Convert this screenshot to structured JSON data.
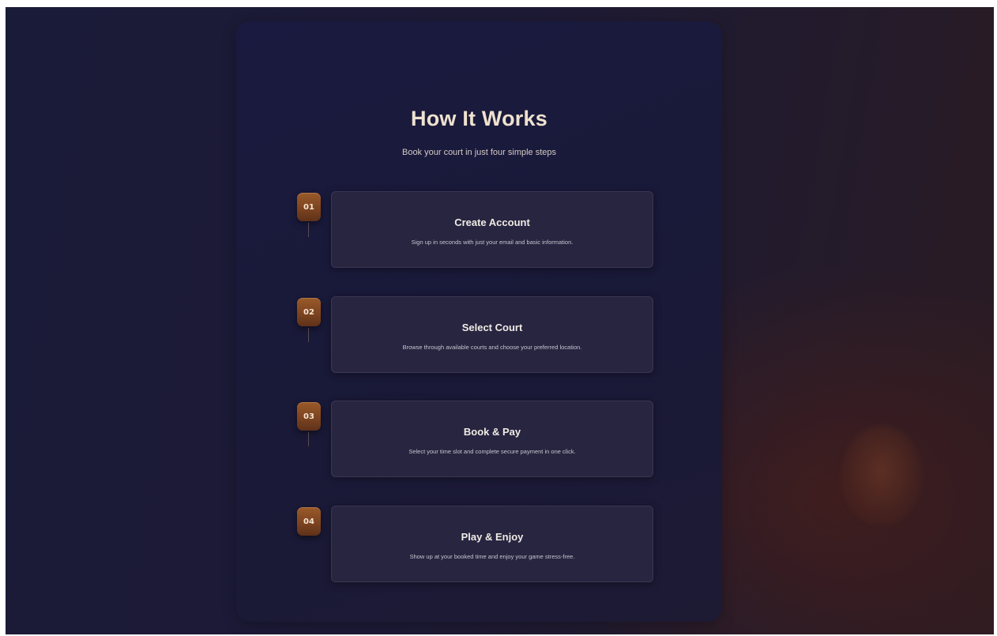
{
  "section": {
    "title": "How It Works",
    "subtitle": "Book your court in just four simple steps"
  },
  "steps": [
    {
      "number": "01",
      "title": "Create Account",
      "description": "Sign up in seconds with just your email and basic information."
    },
    {
      "number": "02",
      "title": "Select Court",
      "description": "Browse through available courts and choose your preferred location."
    },
    {
      "number": "03",
      "title": "Book & Pay",
      "description": "Select your time slot and complete secure payment in one click."
    },
    {
      "number": "04",
      "title": "Play & Enjoy",
      "description": "Show up at your booked time and enjoy your game stress-free."
    }
  ],
  "colors": {
    "accent": "#8a4d24",
    "heading": "#efe2cf",
    "panel": "#1a1a40",
    "card": "#272540"
  }
}
